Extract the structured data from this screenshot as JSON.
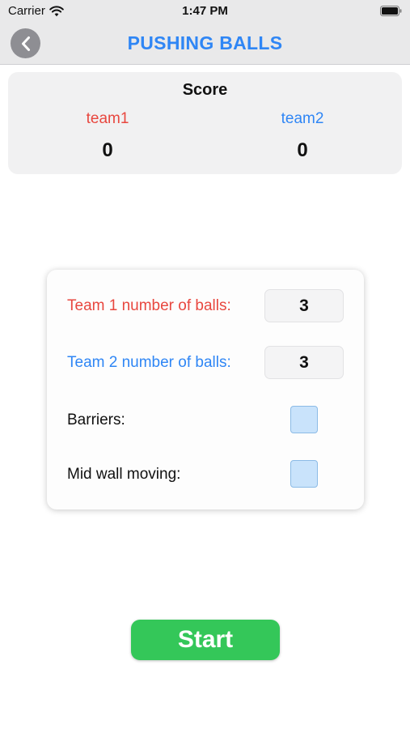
{
  "status_bar": {
    "carrier": "Carrier",
    "time": "1:47 PM",
    "icons": [
      "wifi-icon",
      "battery-icon"
    ]
  },
  "nav": {
    "title": "PUSHING BALLS",
    "back_icon": "chevron-left-icon"
  },
  "score": {
    "title": "Score",
    "team1_name": "team1",
    "team1_score": "0",
    "team2_name": "team2",
    "team2_score": "0"
  },
  "settings": {
    "team1_label": "Team 1 number of balls:",
    "team1_value": "3",
    "team2_label": "Team 2 number of balls:",
    "team2_value": "3",
    "barriers_label": "Barriers:",
    "barriers_checked": false,
    "mid_wall_label": "Mid wall moving:",
    "mid_wall_checked": false
  },
  "start_label": "Start",
  "colors": {
    "accent_blue": "#2f86f5",
    "team1_red": "#e8473f",
    "start_green": "#34c759",
    "checkbox_fill": "#c9e3fb"
  }
}
